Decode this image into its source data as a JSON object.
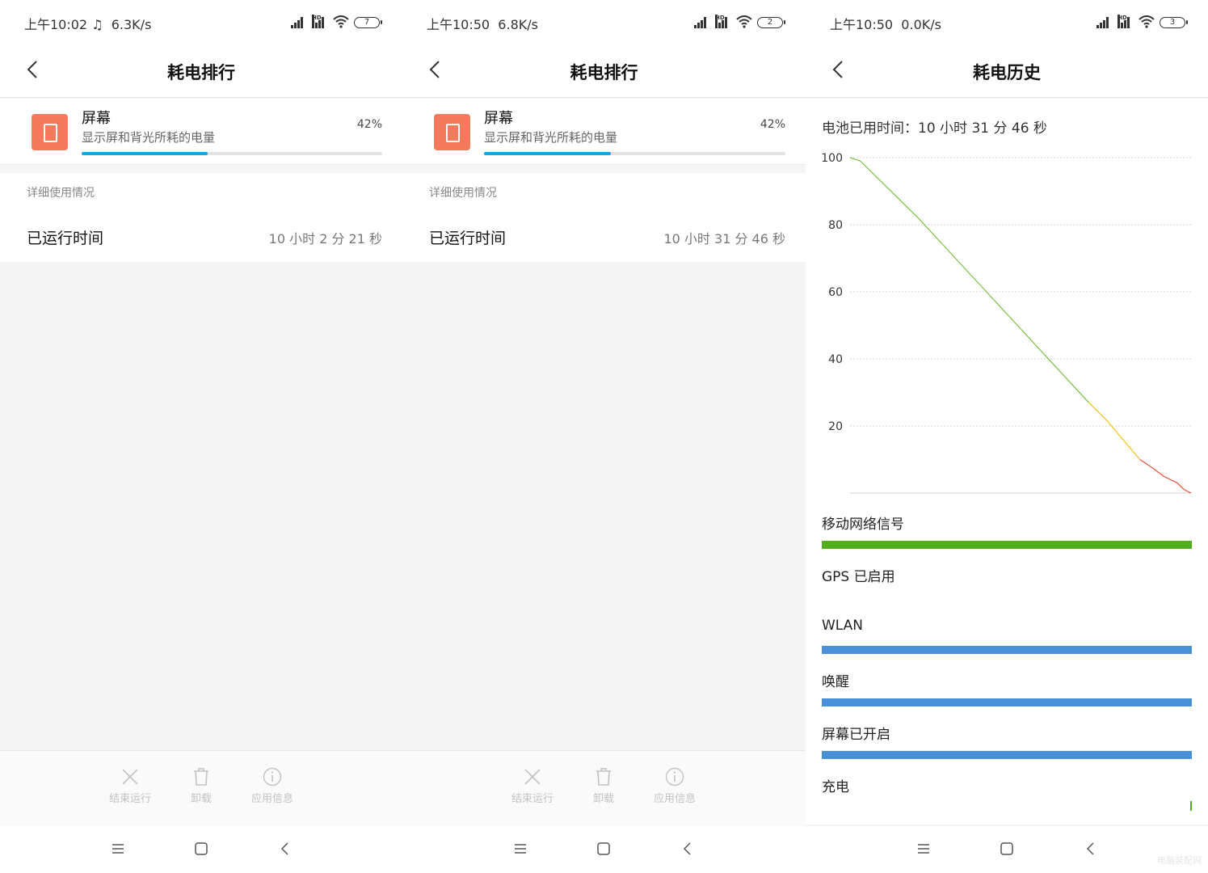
{
  "panels": [
    {
      "status": {
        "time": "上午10:02",
        "speed": "6.3K/s",
        "battery": "7"
      },
      "title": "耗电排行",
      "app": {
        "name": "屏幕",
        "desc": "显示屏和背光所耗的电量",
        "percent_label": "42%",
        "percent": 0.42
      },
      "detail": {
        "header": "详细使用情况",
        "runtime_label": "已运行时间",
        "runtime_value": "10 小时 2 分 21 秒"
      },
      "actions": [
        {
          "label": "结束运行",
          "icon": "close-icon"
        },
        {
          "label": "卸载",
          "icon": "trash-icon"
        },
        {
          "label": "应用信息",
          "icon": "info-icon"
        }
      ]
    },
    {
      "status": {
        "time": "上午10:50",
        "speed": "6.8K/s",
        "battery": "2"
      },
      "title": "耗电排行",
      "app": {
        "name": "屏幕",
        "desc": "显示屏和背光所耗的电量",
        "percent_label": "42%",
        "percent": 0.42
      },
      "detail": {
        "header": "详细使用情况",
        "runtime_label": "已运行时间",
        "runtime_value": "10 小时 31 分 46 秒"
      },
      "actions": [
        {
          "label": "结束运行",
          "icon": "close-icon"
        },
        {
          "label": "卸载",
          "icon": "trash-icon"
        },
        {
          "label": "应用信息",
          "icon": "info-icon"
        }
      ]
    },
    {
      "status": {
        "time": "上午10:50",
        "speed": "0.0K/s",
        "battery": "3"
      },
      "title": "耗电历史",
      "battery_time": "电池已用时间：10 小时 31 分 46 秒",
      "history_rows": [
        {
          "label": "移动网络信号",
          "color": "#52ae1f",
          "bar": true
        },
        {
          "label": "GPS 已启用",
          "color": "#ffffff",
          "bar": false
        },
        {
          "label": "WLAN",
          "color": "#4a90d9",
          "bar": true
        },
        {
          "label": "唤醒",
          "color": "#4a90d9",
          "bar": true
        },
        {
          "label": "屏幕已开启",
          "color": "#4a90d9",
          "bar": true
        },
        {
          "label": "充电",
          "color": "#52ae1f",
          "bar": false
        }
      ]
    }
  ],
  "chart_data": {
    "type": "line",
    "title": "",
    "xlabel": "",
    "ylabel": "",
    "ylim": [
      0,
      100
    ],
    "yticks": [
      100,
      80,
      60,
      40,
      20
    ],
    "grid": true,
    "series": [
      {
        "x": [
          0,
          0.03,
          0.05,
          0.1,
          0.2,
          0.3,
          0.4,
          0.5,
          0.6,
          0.7,
          0.75,
          0.8,
          0.85,
          0.88,
          0.92,
          0.96,
          0.98,
          1.0
        ],
        "values": [
          100,
          99,
          97,
          92,
          82,
          71,
          60,
          49,
          38,
          27,
          22,
          16,
          10,
          8,
          5,
          3,
          1,
          0
        ]
      }
    ],
    "color_thresholds": {
      "green": "#7bc043",
      "yellow": "#f0c419",
      "red": "#e74c3c"
    }
  },
  "watermark": "电脑装配网"
}
